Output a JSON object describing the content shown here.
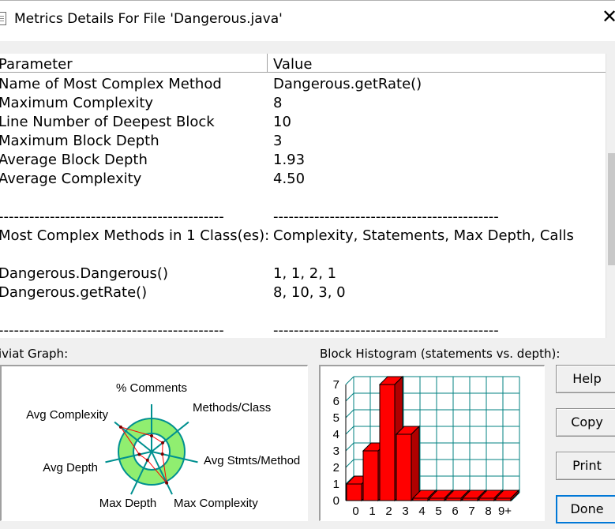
{
  "window": {
    "title": "Metrics Details For File 'Dangerous.java'",
    "close_glyph": "✕",
    "icon": "document-icon"
  },
  "metrics": {
    "columns": [
      "Parameter",
      "Value"
    ],
    "rows": [
      {
        "param": "Name of Most Complex Method",
        "value": "Dangerous.getRate()"
      },
      {
        "param": "Maximum Complexity",
        "value": "8"
      },
      {
        "param": "Line Number of Deepest Block",
        "value": "10"
      },
      {
        "param": "Maximum Block Depth",
        "value": "3"
      },
      {
        "param": "Average Block Depth",
        "value": "1.93"
      },
      {
        "param": "Average Complexity",
        "value": "4.50"
      },
      {
        "param": "",
        "value": ""
      },
      {
        "param": "--------------------------------------------",
        "value": "--------------------------------------------"
      },
      {
        "param": "Most Complex Methods in 1 Class(es):",
        "value": "Complexity, Statements, Max Depth, Calls"
      },
      {
        "param": "",
        "value": ""
      },
      {
        "param": "Dangerous.Dangerous()",
        "value": "1, 1, 2, 1"
      },
      {
        "param": "Dangerous.getRate()",
        "value": "8, 10, 3, 0"
      },
      {
        "param": "",
        "value": ""
      },
      {
        "param": "--------------------------------------------",
        "value": "--------------------------------------------"
      }
    ]
  },
  "kiviat": {
    "label": "iviat Graph:",
    "axes": [
      "% Comments",
      "Methods/Class",
      "Avg Stmts/Method",
      "Max Complexity",
      "Max Depth",
      "Avg Depth",
      "Avg Complexity"
    ],
    "colors": {
      "band": "#90ee70",
      "plot": "#ff0000",
      "axis": "#009090"
    }
  },
  "histogram": {
    "label": "Block Histogram (statements vs. depth):",
    "bar_color": "#ff0000",
    "grid_color": "#008080"
  },
  "buttons": {
    "help": "Help",
    "copy": "Copy",
    "print": "Print",
    "done": "Done"
  },
  "chart_data": {
    "type": "bar",
    "title": "Block Histogram (statements vs. depth):",
    "categories": [
      "0",
      "1",
      "2",
      "3",
      "4",
      "5",
      "6",
      "7",
      "8",
      "9+"
    ],
    "values": [
      1,
      3,
      7,
      4,
      0,
      0,
      0,
      0,
      0,
      0
    ],
    "ylim": [
      0,
      7
    ],
    "yticks": [
      "0",
      "1",
      "2",
      "3",
      "4",
      "5",
      "6",
      "7"
    ],
    "grid": true,
    "style": "3d"
  }
}
